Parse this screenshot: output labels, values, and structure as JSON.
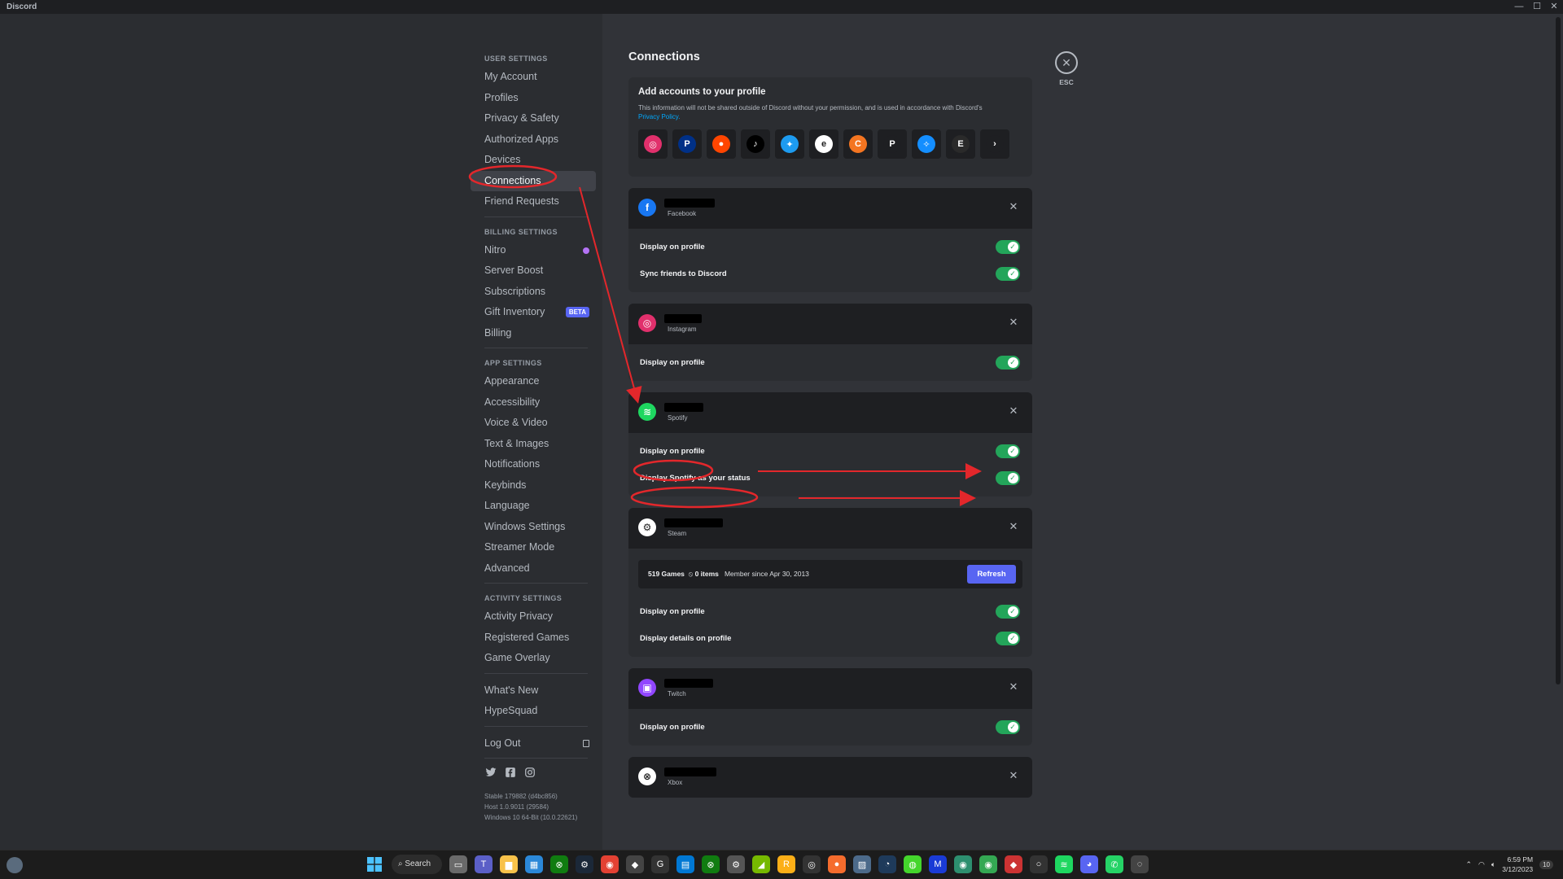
{
  "window": {
    "title": "Discord",
    "minimize": "—",
    "maximize": "☐",
    "close": "✕"
  },
  "sidebar": {
    "user_settings_header": "USER SETTINGS",
    "user_items": [
      "My Account",
      "Profiles",
      "Privacy & Safety",
      "Authorized Apps",
      "Devices",
      "Connections",
      "Friend Requests"
    ],
    "billing_header": "BILLING SETTINGS",
    "billing_items": [
      "Nitro",
      "Server Boost",
      "Subscriptions",
      "Gift Inventory",
      "Billing"
    ],
    "beta_badge": "BETA",
    "app_header": "APP SETTINGS",
    "app_items": [
      "Appearance",
      "Accessibility",
      "Voice & Video",
      "Text & Images",
      "Notifications",
      "Keybinds",
      "Language",
      "Windows Settings",
      "Streamer Mode",
      "Advanced"
    ],
    "activity_header": "ACTIVITY SETTINGS",
    "activity_items": [
      "Activity Privacy",
      "Registered Games",
      "Game Overlay"
    ],
    "misc_items": [
      "What's New",
      "HypeSquad"
    ],
    "logout": "Log Out",
    "version_lines": [
      "Stable 179882 (d4bc856)",
      "Host 1.0.9011 (29584)",
      "Windows 10 64-Bit (10.0.22621)"
    ]
  },
  "main": {
    "title": "Connections",
    "esc_label": "ESC",
    "add_card": {
      "title": "Add accounts to your profile",
      "description": "This information will not be shared outside of Discord without your permission, and is used in accordance with Discord's",
      "privacy_link": "Privacy Policy.",
      "services": [
        {
          "icon": "instagram-icon",
          "color": "#e1306c",
          "glyph": "◎"
        },
        {
          "icon": "paypal-icon",
          "color": "#003087",
          "glyph": "P"
        },
        {
          "icon": "reddit-icon",
          "color": "#ff4500",
          "glyph": "●"
        },
        {
          "icon": "tiktok-icon",
          "color": "#000000",
          "glyph": "♪"
        },
        {
          "icon": "twitter-icon",
          "color": "#1d9bf0",
          "glyph": "✦"
        },
        {
          "icon": "ebay-icon",
          "color": "#ffffff",
          "glyph": "e"
        },
        {
          "icon": "crunchyroll-icon",
          "color": "#f47521",
          "glyph": "C"
        },
        {
          "icon": "playstation-icon",
          "color": "#1e1f22",
          "glyph": "P"
        },
        {
          "icon": "battlenet-icon",
          "color": "#148eff",
          "glyph": "✧"
        },
        {
          "icon": "epic-games-icon",
          "color": "#2a2a2a",
          "glyph": "E"
        },
        {
          "icon": "chevron-right-icon",
          "color": "#1e1f22",
          "glyph": "›"
        }
      ]
    },
    "connections": [
      {
        "service": "Facebook",
        "icon": "facebook-icon",
        "color": "#1877f2",
        "glyph": "f",
        "redact_w": 62,
        "rows": [
          "Display on profile",
          "Sync friends to Discord"
        ]
      },
      {
        "service": "Instagram",
        "icon": "instagram-icon",
        "color": "#e1306c",
        "glyph": "◎",
        "redact_w": 46,
        "rows": [
          "Display on profile"
        ]
      },
      {
        "service": "Spotify",
        "icon": "spotify-icon",
        "color": "#1ed760",
        "glyph": "≋",
        "redact_w": 48,
        "rows": [
          "Display on profile",
          "Display Spotify as your status"
        ]
      },
      {
        "service": "Steam",
        "icon": "steam-icon",
        "color": "#ffffff",
        "glyph": "⚙",
        "redact_w": 72,
        "rows": [
          "Display on profile",
          "Display details on profile"
        ]
      },
      {
        "service": "Twitch",
        "icon": "twitch-icon",
        "color": "#9146ff",
        "glyph": "▣",
        "redact_w": 60,
        "rows": [
          "Display on profile"
        ]
      },
      {
        "service": "Xbox",
        "icon": "xbox-icon",
        "color": "#ffffff",
        "glyph": "⊗",
        "redact_w": 64,
        "rows": []
      }
    ],
    "steam_stats": {
      "games": "519 Games",
      "items": "0 items",
      "member_since": "Member since Apr 30, 2013",
      "refresh": "Refresh"
    }
  },
  "taskbar": {
    "search": "Search",
    "time": "6:59 PM",
    "date": "3/12/2023",
    "notif_count": "10"
  },
  "colors": {
    "accent": "#5865f2",
    "toggle_on": "#23a55a",
    "annotation": "#e3272b"
  }
}
